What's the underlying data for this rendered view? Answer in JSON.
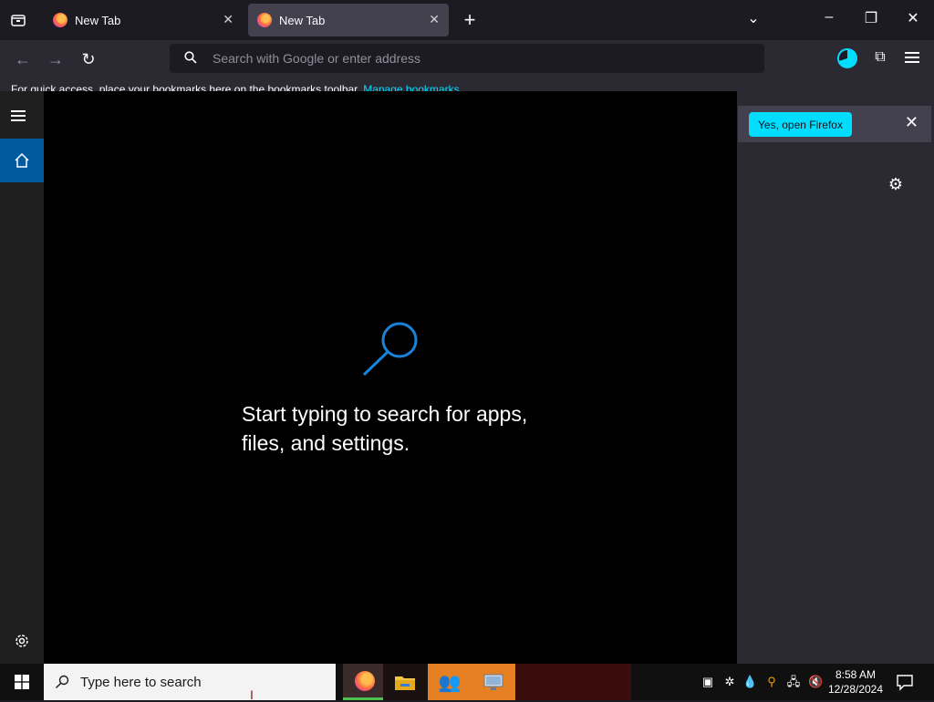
{
  "browser": {
    "tabs": [
      {
        "label": "New Tab",
        "active": false
      },
      {
        "label": "New Tab",
        "active": true
      }
    ],
    "new_tab_icon": "+",
    "address_placeholder": "Search with Google or enter address",
    "bookmarks_bar": {
      "text": "For quick access, place your bookmarks here on the bookmarks toolbar.",
      "link": "Manage bookmarks"
    },
    "notification": {
      "button": "Yes, open Firefox"
    }
  },
  "search_flyout": {
    "message_line1": "Start typing to search for apps,",
    "message_line2": "files, and settings."
  },
  "taskbar": {
    "search_placeholder": "Type here to search",
    "clock_time": "8:58 AM",
    "clock_date": "12/28/2024"
  },
  "colors": {
    "accent_cyan": "#00ddff",
    "windows_blue": "#005a9e",
    "search_icon_blue": "#1a82d9"
  }
}
